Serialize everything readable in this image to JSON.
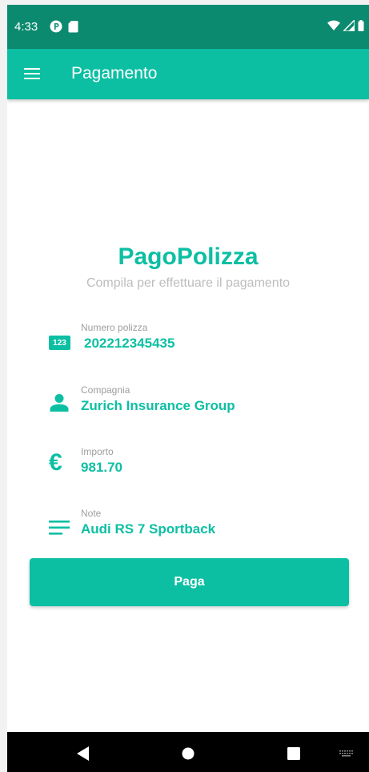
{
  "status_bar": {
    "time": "4:33",
    "icons": [
      "p-badge-icon",
      "sd-card-icon",
      "wifi-icon",
      "signal-icon",
      "battery-icon"
    ]
  },
  "app_bar": {
    "title": "Pagamento",
    "menu_icon": "menu-icon"
  },
  "brand": {
    "title": "PagoPolizza",
    "subtitle": "Compila per effettuare il pagamento"
  },
  "fields": {
    "policy_number": {
      "label": "Numero polizza",
      "value": "202212345435",
      "icon": "numeric-icon",
      "icon_text": "123"
    },
    "company": {
      "label": "Compagnia",
      "value": "Zurich Insurance Group",
      "icon": "person-icon"
    },
    "amount": {
      "label": "Importo",
      "value": "981.70",
      "icon": "euro-icon",
      "icon_text": "€"
    },
    "notes": {
      "label": "Note",
      "value": "Audi RS 7 Sportback",
      "icon": "notes-icon"
    }
  },
  "pay_button": {
    "label": "Paga"
  },
  "nav_bar": {
    "buttons": [
      "back-icon",
      "home-icon",
      "recents-icon",
      "keyboard-icon"
    ]
  },
  "colors": {
    "accent": "#0cbfa3",
    "status_bar": "#0c8a70",
    "label_gray": "#9e9e9e",
    "subtitle_gray": "#bdbdbd"
  }
}
